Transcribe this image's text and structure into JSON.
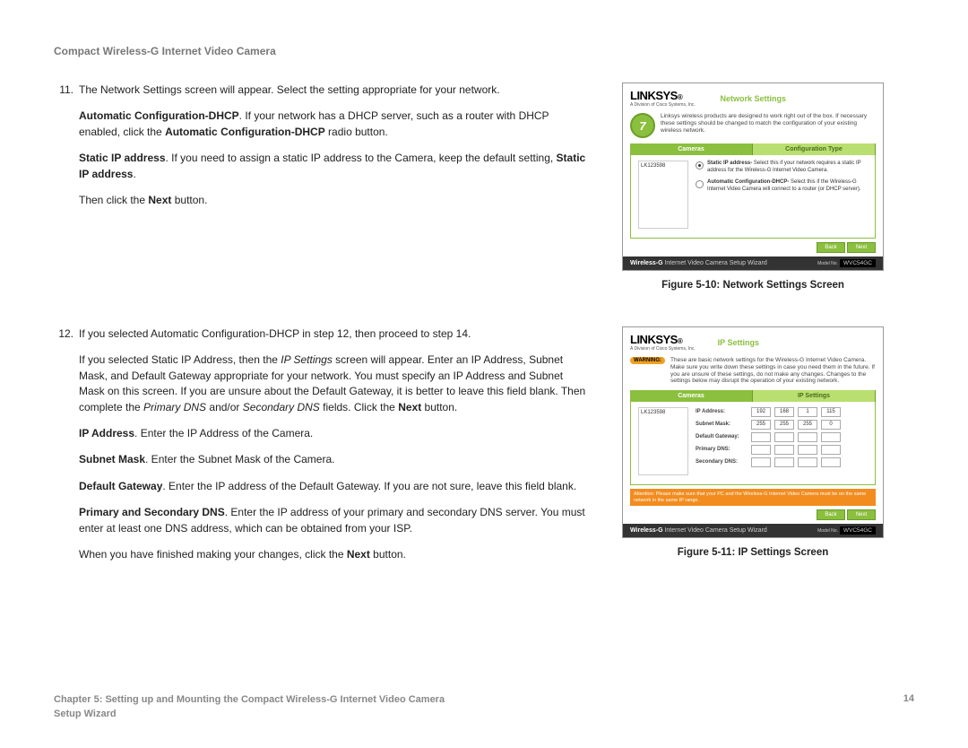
{
  "header": {
    "doc_title": "Compact Wireless-G Internet Video Camera"
  },
  "section1": {
    "step_num": "11.",
    "intro": "The Network Settings screen will appear. Select the setting appropriate for your network.",
    "p1_a": "Automatic Configuration-DHCP",
    "p1_b": ". If your network has a DHCP server, such as a router with DHCP enabled, click the ",
    "p1_c": "Automatic Configuration-DHCP",
    "p1_d": " radio button.",
    "p2_a": "Static IP address",
    "p2_b": ". If you need to assign a static IP address to the Camera, keep the default setting, ",
    "p2_c": "Static IP address",
    "p2_d": ".",
    "p3_a": "Then click the ",
    "p3_b": "Next",
    "p3_c": " button."
  },
  "section2": {
    "step_num": "12.",
    "intro": "If you selected Automatic Configuration-DHCP in step 12, then proceed to step 14.",
    "p1_a": "If you selected Static IP Address, then the ",
    "p1_b": "IP Settings",
    "p1_c": " screen will appear. Enter an IP Address, Subnet Mask, and Default Gateway appropriate for your network. You must specify an IP Address and Subnet Mask on this screen. If you are unsure about the Default Gateway, it is better to leave this field blank. Then complete the ",
    "p1_d": "Primary DNS",
    "p1_e": " and/or ",
    "p1_f": "Secondary DNS",
    "p1_g": " fields. Click the ",
    "p1_h": "Next",
    "p1_i": " button.",
    "p2_a": "IP Address",
    "p2_b": ". Enter the IP Address of the Camera.",
    "p3_a": "Subnet Mask",
    "p3_b": ". Enter the Subnet Mask of the Camera.",
    "p4_a": "Default Gateway",
    "p4_b": ". Enter the IP address of the Default Gateway. If you are not sure, leave this field blank.",
    "p5_a": "Primary and Secondary DNS",
    "p5_b": ". Enter the IP address of your primary and secondary DNS server. You must enter at least one DNS address, which can be obtained from your ISP.",
    "p6_a": "When you have finished making your changes, click the ",
    "p6_b": "Next",
    "p6_c": " button."
  },
  "figures": {
    "fig1_caption": "Figure 5-10: Network Settings Screen",
    "fig2_caption": "Figure 5-11: IP Settings Screen"
  },
  "wizard_common": {
    "logo": "LINKSYS",
    "logo_sub": "A Division of Cisco Systems, Inc.",
    "footer_a": "Wireless-",
    "footer_b": "G",
    "footer_c": " Internet Video Camera Setup Wizard",
    "model_label": "Model No.",
    "model": "WVC54GC",
    "nav_back": "Back",
    "nav_next": "Next",
    "tab_cameras": "Cameras",
    "camera_id": "LK123598"
  },
  "wizard1": {
    "title": "Network Settings",
    "step_badge": "7",
    "desc": "Linksys wireless products are designed to work right out of the box. If necessary these settings should be changed to match the configuration of your existing wireless network.",
    "tab2": "Configuration Type",
    "opt1_bold": "Static IP address-",
    "opt1_rest": " Select this if your network requires a static IP address for the Wireless-G Internet Video Camera.",
    "opt2_bold": "Automatic Configuration-DHCP-",
    "opt2_rest": " Select this if the Wireless-G Internet Video Camera will connect to a router (or DHCP server)."
  },
  "wizard2": {
    "title": "IP Settings",
    "desc": "These are basic network settings for the Wireless-G Internet Video Camera. Make sure you write down these settings in case you need them in the future. If you are unsure of these settings, do not make any changes. Changes to the settings below may disrupt the operation of your existing network.",
    "warning": "WARNING:",
    "tab2": "IP Settings",
    "row_ip": "IP Address:",
    "row_subnet": "Subnet Mask:",
    "row_gateway": "Default Gateway:",
    "row_pdns": "Primary DNS:",
    "row_sdns": "Secondary DNS:",
    "ip_vals": [
      "192",
      "168",
      "1",
      "115"
    ],
    "subnet_vals": [
      "255",
      "255",
      "255",
      "0"
    ]
  },
  "footer": {
    "chapter": "Chapter 5: Setting up and Mounting the Compact Wireless-G Internet Video Camera",
    "sub": "Setup Wizard",
    "page": "14"
  }
}
